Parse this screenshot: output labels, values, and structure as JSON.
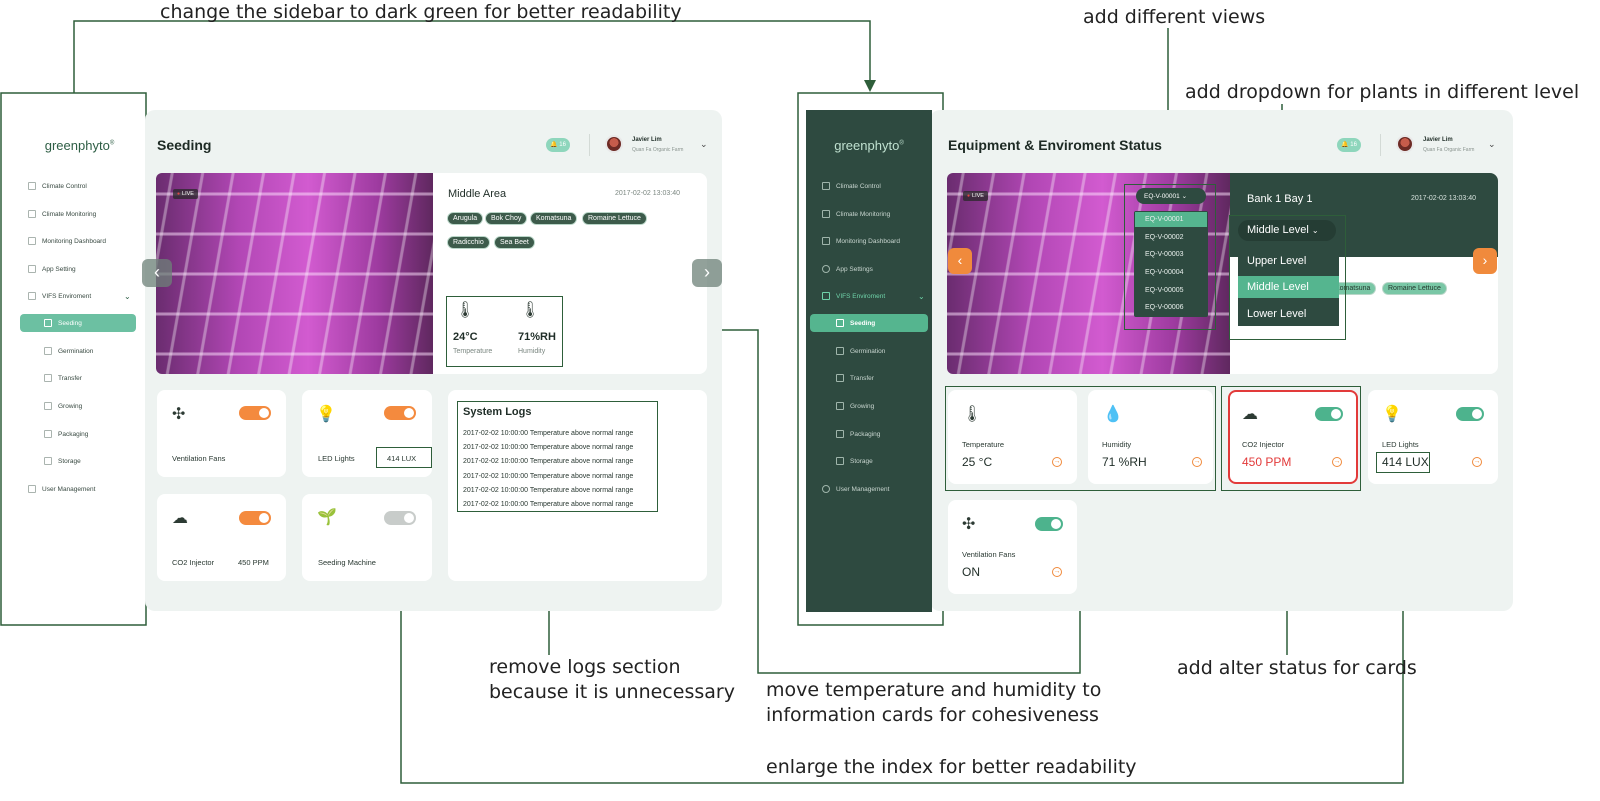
{
  "annotations": {
    "sidebar_color": "change the sidebar to dark green for better readability",
    "views": "add different views",
    "dropdown": "add dropdown for plants in different level",
    "remove_logs": [
      "remove logs section",
      "because it is unnecessary"
    ],
    "move_temp": [
      "move temperature and humidity to",
      "information cards for cohesiveness"
    ],
    "alert_status": "add alter status for cards",
    "enlarge_index": "enlarge the index for better readability"
  },
  "brand": {
    "name": "greenphyto",
    "mark": "®"
  },
  "user": {
    "name": "Javier Lim",
    "org": "Quan Fa Organic Farm",
    "notifications": "16"
  },
  "sidebar": {
    "items": [
      "Climate Control",
      "Climate Monitoring",
      "Monitoring Dashboard"
    ],
    "app_setting_left": "App Setting",
    "app_setting_right": "App Settings",
    "vifs": "VIFS Enviroment",
    "sub_items": [
      "Seeding",
      "Germination",
      "Transfer",
      "Growing",
      "Packaging",
      "Storage"
    ],
    "user_mgmt": "User Management"
  },
  "left": {
    "title": "Seeding",
    "live": "LIVE",
    "area_title": "Middle Area",
    "timestamp": "2017-02-02 13:03:40",
    "tags": [
      "Arugula",
      "Bok Choy",
      "Komatsuna",
      "Romaine Lettuce",
      "Radicchio",
      "Sea Beet"
    ],
    "temperature": {
      "value": "24°C",
      "label": "Temperature"
    },
    "humidity": {
      "value": "71%RH",
      "label": "Humidity"
    },
    "cards": {
      "fans": "Ventilation Fans",
      "led": "LED Lights",
      "led_value": "414 LUX",
      "co2": "CO2 Injector",
      "co2_value": "450 PPM",
      "seeding_machine": "Seeding Machine"
    },
    "logs_title": "System Logs",
    "logs": [
      "2017-02-02 10:00:00 Temperature above normal range",
      "2017-02-02 10:00:00 Temperature above normal range",
      "2017-02-02 10:00:00 Temperature above normal range",
      "2017-02-02 10:00:00 Temperature above normal range",
      "2017-02-02 10:00:00 Temperature above normal range",
      "2017-02-02 10:00:00 Temperature above normal range"
    ]
  },
  "right": {
    "title": "Equipment & Enviroment Status",
    "live": "LIVE",
    "equipment_selected": "EQ-V-00001",
    "equipment_list": [
      "EQ-V-00001",
      "EQ-V-00002",
      "EQ-V-00003",
      "EQ-V-00004",
      "EQ-V-00005",
      "EQ-V-00006"
    ],
    "bank": "Bank 1 Bay 1",
    "timestamp": "2017-02-02 13:03:40",
    "level_selected": "Middle Level",
    "levels": [
      "Upper Level",
      "Middle Level",
      "Lower Level"
    ],
    "tags_visible": [
      "Komatsuna",
      "Romaine Lettuce"
    ],
    "cards": [
      {
        "label": "Temperature",
        "value": "25 °C"
      },
      {
        "label": "Humidity",
        "value": "71 %RH"
      },
      {
        "label": "CO2 Injector",
        "value": "450 PPM"
      },
      {
        "label": "LED Lights",
        "value": "414 LUX"
      },
      {
        "label": "Ventilation Fans",
        "value": "ON"
      }
    ]
  },
  "colors": {
    "accent": "#4db38d",
    "dark_sidebar": "#2e4a40",
    "alert": "#e23a3a",
    "orange": "#f08a3c",
    "annotation_line": "#2e5e3a"
  }
}
